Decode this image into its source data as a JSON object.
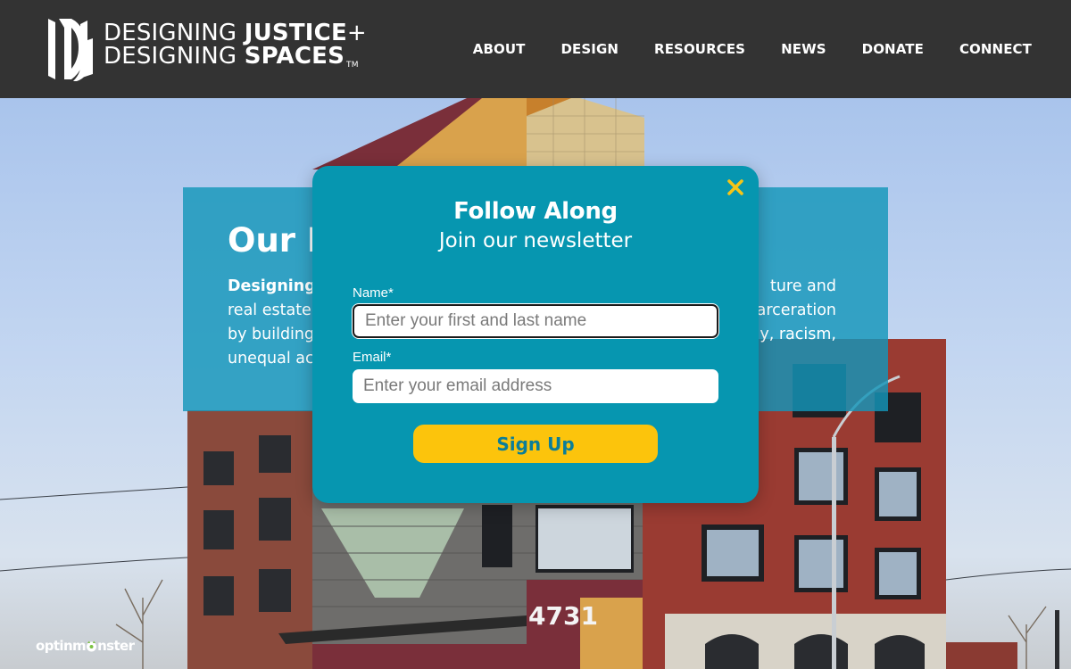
{
  "header": {
    "logo": {
      "line1_regular": "DESIGNING ",
      "line1_bold": "JUSTICE",
      "line1_plus": "+",
      "line2_regular": "DESIGNING ",
      "line2_bold": "SPACES",
      "trademark": "TM"
    },
    "nav": [
      {
        "label": "ABOUT"
      },
      {
        "label": "DESIGN"
      },
      {
        "label": "RESOURCES"
      },
      {
        "label": "NEWS"
      },
      {
        "label": "DONATE"
      },
      {
        "label": "CONNECT"
      }
    ]
  },
  "mission": {
    "heading_visible": "Our M",
    "left_lines": [
      "Designing",
      "real estate",
      "by building",
      "unequal ac"
    ],
    "right_lines": [
      "ture and",
      "arceration",
      "y, racism,",
      ""
    ]
  },
  "building": {
    "address_number": "4731"
  },
  "popup": {
    "title": "Follow Along",
    "subtitle": "Join our newsletter",
    "name_label": "Name*",
    "name_placeholder": "Enter your first and last name",
    "email_label": "Email*",
    "email_placeholder": "Enter your email address",
    "signup_label": "Sign Up",
    "close_icon_color": "#f5c518"
  },
  "badge": {
    "brand_pre": "optinm",
    "brand_post": "nster"
  },
  "colors": {
    "header_bg": "#333333",
    "popup_bg": "#0696b0",
    "signup_bg": "#fcc40c",
    "signup_text": "#0b7e98",
    "mission_bg": "#1496b9"
  }
}
